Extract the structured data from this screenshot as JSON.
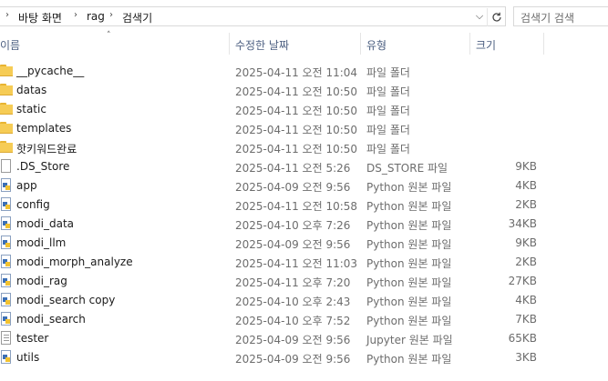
{
  "address": {
    "breadcrumbs": [
      "바탕 화면",
      "rag",
      "검색기"
    ],
    "search_placeholder": "검색기 검색"
  },
  "columns": {
    "name": "이름",
    "modified": "수정한 날짜",
    "type": "유형",
    "size": "크기"
  },
  "files": [
    {
      "name": "__pycache__",
      "modified": "2025-04-11 오전 11:04",
      "type": "파일 폴더",
      "size": "",
      "icon": "folder-icon"
    },
    {
      "name": "datas",
      "modified": "2025-04-11 오전 10:50",
      "type": "파일 폴더",
      "size": "",
      "icon": "folder-icon"
    },
    {
      "name": "static",
      "modified": "2025-04-11 오전 10:50",
      "type": "파일 폴더",
      "size": "",
      "icon": "folder-icon"
    },
    {
      "name": "templates",
      "modified": "2025-04-11 오전 10:50",
      "type": "파일 폴더",
      "size": "",
      "icon": "folder-icon"
    },
    {
      "name": "핫키워드완료",
      "modified": "2025-04-11 오전 10:50",
      "type": "파일 폴더",
      "size": "",
      "icon": "folder-icon"
    },
    {
      "name": ".DS_Store",
      "modified": "2025-04-11 오전 5:26",
      "type": "DS_STORE 파일",
      "size": "9KB",
      "icon": "file-icon"
    },
    {
      "name": "app",
      "modified": "2025-04-09 오전 9:56",
      "type": "Python 원본 파일",
      "size": "4KB",
      "icon": "python-file-icon"
    },
    {
      "name": "config",
      "modified": "2025-04-11 오전 10:58",
      "type": "Python 원본 파일",
      "size": "2KB",
      "icon": "python-file-icon"
    },
    {
      "name": "modi_data",
      "modified": "2025-04-10 오후 7:26",
      "type": "Python 원본 파일",
      "size": "34KB",
      "icon": "python-file-icon"
    },
    {
      "name": "modi_llm",
      "modified": "2025-04-09 오전 9:56",
      "type": "Python 원본 파일",
      "size": "9KB",
      "icon": "python-file-icon"
    },
    {
      "name": "modi_morph_analyze",
      "modified": "2025-04-11 오전 11:03",
      "type": "Python 원본 파일",
      "size": "2KB",
      "icon": "python-file-icon"
    },
    {
      "name": "modi_rag",
      "modified": "2025-04-11 오후 7:20",
      "type": "Python 원본 파일",
      "size": "27KB",
      "icon": "python-file-icon"
    },
    {
      "name": "modi_search copy",
      "modified": "2025-04-10 오후 2:43",
      "type": "Python 원본 파일",
      "size": "4KB",
      "icon": "python-file-icon"
    },
    {
      "name": "modi_search",
      "modified": "2025-04-10 오후 7:52",
      "type": "Python 원본 파일",
      "size": "7KB",
      "icon": "python-file-icon"
    },
    {
      "name": "tester",
      "modified": "2025-04-09 오전 9:56",
      "type": "Jupyter 원본 파일",
      "size": "65KB",
      "icon": "notebook-file-icon"
    },
    {
      "name": "utils",
      "modified": "2025-04-09 오전 9:56",
      "type": "Python 원본 파일",
      "size": "3KB",
      "icon": "python-file-icon"
    }
  ]
}
